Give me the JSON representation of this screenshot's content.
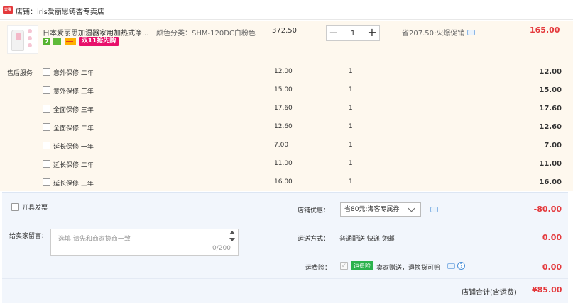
{
  "shop": {
    "badge": "天猫",
    "name": "店铺：iris爱丽思铸杏专卖店"
  },
  "product": {
    "title": "日本爱丽思加湿器家用加热式净...",
    "spec": "颜色分类：SHM-120DC白粉色",
    "tag_seven": "7",
    "promo_tag": "双11抢先购",
    "unit_price": "372.50",
    "quantity": "1",
    "discount": "省207.50:火爆促销",
    "total": "165.00"
  },
  "stepper": {
    "minus": "−",
    "plus": "+"
  },
  "services": {
    "label": "售后服务",
    "rows": [
      {
        "name": "意外保修 二年",
        "price": "12.00",
        "qty": "1",
        "total": "12.00"
      },
      {
        "name": "意外保修 三年",
        "price": "15.00",
        "qty": "1",
        "total": "15.00"
      },
      {
        "name": "全面保修 三年",
        "price": "17.60",
        "qty": "1",
        "total": "17.60"
      },
      {
        "name": "全面保修 二年",
        "price": "12.60",
        "qty": "1",
        "total": "12.60"
      },
      {
        "name": "延长保修 一年",
        "price": "7.00",
        "qty": "1",
        "total": "7.00"
      },
      {
        "name": "延长保修 二年",
        "price": "11.00",
        "qty": "1",
        "total": "11.00"
      },
      {
        "name": "延长保修 三年",
        "price": "16.00",
        "qty": "1",
        "total": "16.00"
      }
    ]
  },
  "invoice": {
    "label": "开具发票"
  },
  "message": {
    "label": "给卖家留言：",
    "placeholder": "选填,请先和商家协商一致",
    "count": "0/200"
  },
  "coupon": {
    "label": "店铺优惠：",
    "selected": "省80元:海客专属券",
    "value": "-80.00"
  },
  "shipping": {
    "label": "运送方式：",
    "option": "普通配送 快递 免邮",
    "value": "0.00"
  },
  "insurance": {
    "label": "运费险：",
    "check_mark": "✓",
    "badge": "运费险",
    "text": "卖家赠送，退换货可赔",
    "help": "?",
    "value": "0.00"
  },
  "summary": {
    "label": "店铺合计(含运费)",
    "value": "¥85.00"
  },
  "colors": {
    "accent_red": "#e4393c",
    "row_bg": "#fef8ee",
    "panel_bg": "#f2f6fc",
    "promo_pink": "#e8106a",
    "insurance_green": "#2bb24c"
  }
}
